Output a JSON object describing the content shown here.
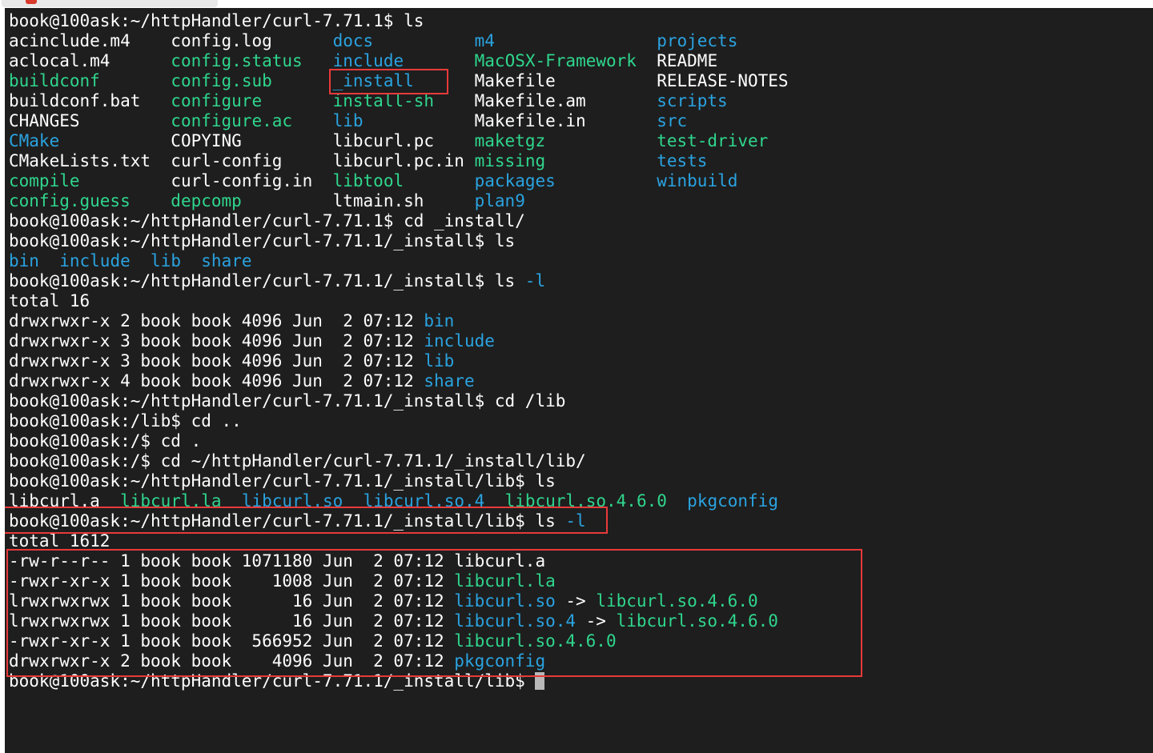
{
  "colors": {
    "background": "#1e1e1e",
    "text": "#ffffff",
    "directory": "#2aa3e0",
    "executable": "#2fd68d",
    "highlight_box": "#e83a3a"
  },
  "terminal": {
    "lines": [
      [
        {
          "t": "book@100ask:~/httpHandler/curl-7.71.1$ ls",
          "c": "norm"
        }
      ],
      [
        {
          "t": "acinclude.m4    ",
          "c": "norm"
        },
        {
          "t": "config.log      ",
          "c": "norm"
        },
        {
          "t": "docs",
          "c": "dir"
        },
        {
          "t": "          ",
          "c": "norm"
        },
        {
          "t": "m4",
          "c": "dir"
        },
        {
          "t": "                ",
          "c": "norm"
        },
        {
          "t": "projects",
          "c": "dir"
        }
      ],
      [
        {
          "t": "aclocal.m4      ",
          "c": "norm"
        },
        {
          "t": "config.status",
          "c": "exe"
        },
        {
          "t": "   ",
          "c": "norm"
        },
        {
          "t": "include",
          "c": "dir"
        },
        {
          "t": "       ",
          "c": "norm"
        },
        {
          "t": "MacOSX-Framework",
          "c": "exe"
        },
        {
          "t": "  ",
          "c": "norm"
        },
        {
          "t": "README",
          "c": "norm"
        }
      ],
      [
        {
          "t": "buildconf",
          "c": "exe"
        },
        {
          "t": "       ",
          "c": "norm"
        },
        {
          "t": "config.sub",
          "c": "exe"
        },
        {
          "t": "      ",
          "c": "norm"
        },
        {
          "t": "_install",
          "c": "dir"
        },
        {
          "t": "      ",
          "c": "norm"
        },
        {
          "t": "Makefile          ",
          "c": "norm"
        },
        {
          "t": "RELEASE-NOTES",
          "c": "norm"
        }
      ],
      [
        {
          "t": "buildconf.bat   ",
          "c": "norm"
        },
        {
          "t": "configure",
          "c": "exe"
        },
        {
          "t": "       ",
          "c": "norm"
        },
        {
          "t": "install-sh",
          "c": "exe"
        },
        {
          "t": "    ",
          "c": "norm"
        },
        {
          "t": "Makefile.am       ",
          "c": "norm"
        },
        {
          "t": "scripts",
          "c": "dir"
        }
      ],
      [
        {
          "t": "CHANGES         ",
          "c": "norm"
        },
        {
          "t": "configure.ac",
          "c": "exe"
        },
        {
          "t": "    ",
          "c": "norm"
        },
        {
          "t": "lib",
          "c": "dir"
        },
        {
          "t": "           ",
          "c": "norm"
        },
        {
          "t": "Makefile.in       ",
          "c": "norm"
        },
        {
          "t": "src",
          "c": "dir"
        }
      ],
      [
        {
          "t": "CMake",
          "c": "dir"
        },
        {
          "t": "           ",
          "c": "norm"
        },
        {
          "t": "COPYING         ",
          "c": "norm"
        },
        {
          "t": "libcurl.pc    ",
          "c": "norm"
        },
        {
          "t": "maketgz",
          "c": "exe"
        },
        {
          "t": "           ",
          "c": "norm"
        },
        {
          "t": "test-driver",
          "c": "exe"
        }
      ],
      [
        {
          "t": "CMakeLists.txt  ",
          "c": "norm"
        },
        {
          "t": "curl-config     ",
          "c": "norm"
        },
        {
          "t": "libcurl.pc.in ",
          "c": "norm"
        },
        {
          "t": "missing",
          "c": "exe"
        },
        {
          "t": "           ",
          "c": "norm"
        },
        {
          "t": "tests",
          "c": "dir"
        }
      ],
      [
        {
          "t": "compile",
          "c": "exe"
        },
        {
          "t": "         ",
          "c": "norm"
        },
        {
          "t": "curl-config.in  ",
          "c": "norm"
        },
        {
          "t": "libtool",
          "c": "exe"
        },
        {
          "t": "       ",
          "c": "norm"
        },
        {
          "t": "packages",
          "c": "dir"
        },
        {
          "t": "          ",
          "c": "norm"
        },
        {
          "t": "winbuild",
          "c": "dir"
        }
      ],
      [
        {
          "t": "config.guess",
          "c": "exe"
        },
        {
          "t": "    ",
          "c": "norm"
        },
        {
          "t": "depcomp",
          "c": "exe"
        },
        {
          "t": "         ",
          "c": "norm"
        },
        {
          "t": "ltmain.sh     ",
          "c": "norm"
        },
        {
          "t": "plan9",
          "c": "dir"
        }
      ],
      [
        {
          "t": "book@100ask:~/httpHandler/curl-7.71.1$ cd _install/",
          "c": "norm"
        }
      ],
      [
        {
          "t": "book@100ask:~/httpHandler/curl-7.71.1/_install$ ls",
          "c": "norm"
        }
      ],
      [
        {
          "t": "bin",
          "c": "dir"
        },
        {
          "t": "  ",
          "c": "norm"
        },
        {
          "t": "include",
          "c": "dir"
        },
        {
          "t": "  ",
          "c": "norm"
        },
        {
          "t": "lib",
          "c": "dir"
        },
        {
          "t": "  ",
          "c": "norm"
        },
        {
          "t": "share",
          "c": "dir"
        }
      ],
      [
        {
          "t": "book@100ask:~/httpHandler/curl-7.71.1/_install$ ls ",
          "c": "norm"
        },
        {
          "t": "-l",
          "c": "dir"
        }
      ],
      [
        {
          "t": "total 16",
          "c": "norm"
        }
      ],
      [
        {
          "t": "drwxrwxr-x 2 book book 4096 Jun  2 07:12 ",
          "c": "norm"
        },
        {
          "t": "bin",
          "c": "dir"
        }
      ],
      [
        {
          "t": "drwxrwxr-x 3 book book 4096 Jun  2 07:12 ",
          "c": "norm"
        },
        {
          "t": "include",
          "c": "dir"
        }
      ],
      [
        {
          "t": "drwxrwxr-x 3 book book 4096 Jun  2 07:12 ",
          "c": "norm"
        },
        {
          "t": "lib",
          "c": "dir"
        }
      ],
      [
        {
          "t": "drwxrwxr-x 4 book book 4096 Jun  2 07:12 ",
          "c": "norm"
        },
        {
          "t": "share",
          "c": "dir"
        }
      ],
      [
        {
          "t": "book@100ask:~/httpHandler/curl-7.71.1/_install$ cd /lib",
          "c": "norm"
        }
      ],
      [
        {
          "t": "book@100ask:/lib$ cd ..",
          "c": "norm"
        }
      ],
      [
        {
          "t": "book@100ask:/$ cd .",
          "c": "norm"
        }
      ],
      [
        {
          "t": "book@100ask:/$ cd ~/httpHandler/curl-7.71.1/_install/lib/",
          "c": "norm"
        }
      ],
      [
        {
          "t": "book@100ask:~/httpHandler/curl-7.71.1/_install/lib$ ls",
          "c": "norm"
        }
      ],
      [
        {
          "t": "libcurl.a",
          "c": "norm"
        },
        {
          "t": "  ",
          "c": "norm"
        },
        {
          "t": "libcurl.la",
          "c": "exe"
        },
        {
          "t": "  ",
          "c": "norm"
        },
        {
          "t": "libcurl.so",
          "c": "dir"
        },
        {
          "t": "  ",
          "c": "norm"
        },
        {
          "t": "libcurl.so.4",
          "c": "dir"
        },
        {
          "t": "  ",
          "c": "norm"
        },
        {
          "t": "libcurl.so.4.6.0",
          "c": "exe"
        },
        {
          "t": "  ",
          "c": "norm"
        },
        {
          "t": "pkgconfig",
          "c": "dir"
        }
      ],
      [
        {
          "t": "book@100ask:~/httpHandler/curl-7.71.1/_install/lib$ ls ",
          "c": "norm"
        },
        {
          "t": "-l",
          "c": "dir"
        }
      ],
      [
        {
          "t": "total 1612",
          "c": "norm"
        }
      ],
      [
        {
          "t": "-rw-r--r-- 1 book book 1071180 Jun  2 07:12 ",
          "c": "norm"
        },
        {
          "t": "libcurl.a",
          "c": "norm"
        }
      ],
      [
        {
          "t": "-rwxr-xr-x 1 book book    1008 Jun  2 07:12 ",
          "c": "norm"
        },
        {
          "t": "libcurl.la",
          "c": "exe"
        }
      ],
      [
        {
          "t": "lrwxrwxrwx 1 book book      16 Jun  2 07:12 ",
          "c": "norm"
        },
        {
          "t": "libcurl.so",
          "c": "dir"
        },
        {
          "t": " -> ",
          "c": "norm"
        },
        {
          "t": "libcurl.so.4.6.0",
          "c": "exe"
        }
      ],
      [
        {
          "t": "lrwxrwxrwx 1 book book      16 Jun  2 07:12 ",
          "c": "norm"
        },
        {
          "t": "libcurl.so.4",
          "c": "dir"
        },
        {
          "t": " -> ",
          "c": "norm"
        },
        {
          "t": "libcurl.so.4.6.0",
          "c": "exe"
        }
      ],
      [
        {
          "t": "-rwxr-xr-x 1 book book  566952 Jun  2 07:12 ",
          "c": "norm"
        },
        {
          "t": "libcurl.so.4.6.0",
          "c": "exe"
        }
      ],
      [
        {
          "t": "drwxrwxr-x 2 book book    4096 Jun  2 07:12 ",
          "c": "norm"
        },
        {
          "t": "pkgconfig",
          "c": "dir"
        }
      ],
      [
        {
          "t": "book@100ask:~/httpHandler/curl-7.71.1/_install/lib$ ",
          "c": "norm"
        }
      ]
    ]
  }
}
